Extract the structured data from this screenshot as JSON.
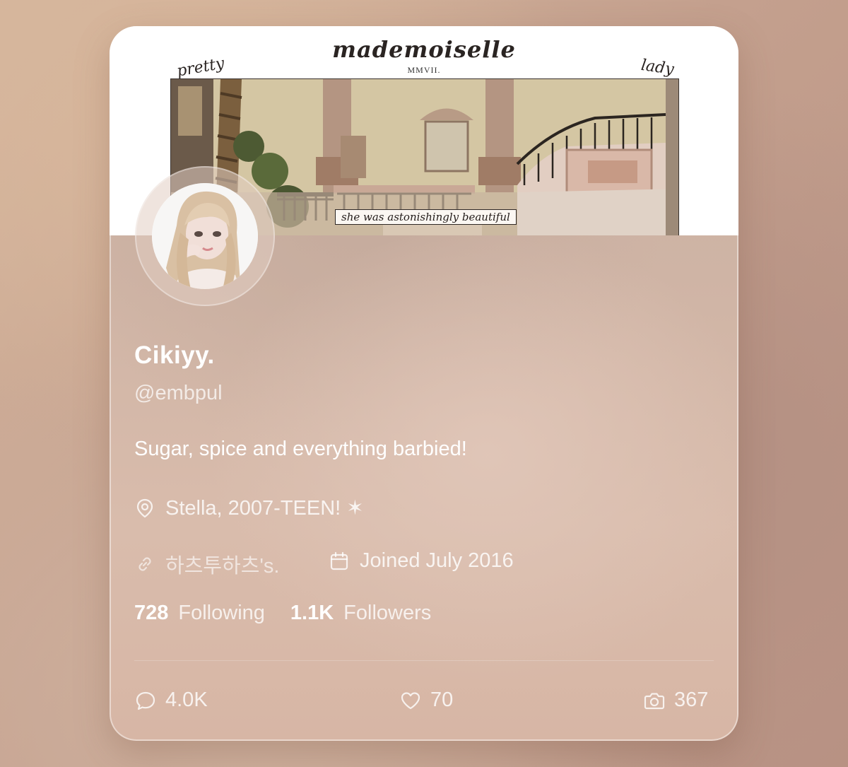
{
  "banner": {
    "title": "mademoiselle",
    "subtitle": "MMVII.",
    "left_word": "pretty",
    "right_word": "lady",
    "caption": "she was astonishingly beautiful"
  },
  "profile": {
    "name": "Cikiyy.",
    "handle": "@embpul",
    "bio": "Sugar, spice and everything barbied!",
    "location": "Stella, 2007-TEEN! ✶",
    "link": "하츠투하츠's.",
    "joined": "Joined July 2016"
  },
  "stats": {
    "following_count": "728",
    "following_label": "Following",
    "followers_count": "1.1K",
    "followers_label": "Followers"
  },
  "actions": {
    "comments": "4.0K",
    "likes": "70",
    "views": "367"
  },
  "colors": {
    "text_primary": "#ffffff",
    "card_bg": "#d2b5a6",
    "banner_bg": "#ffffff"
  },
  "icons": {
    "location": "map-pin-icon",
    "link": "link-icon",
    "joined": "calendar-icon",
    "comments": "comment-bubble-icon",
    "likes": "heart-icon",
    "views": "camera-icon"
  }
}
